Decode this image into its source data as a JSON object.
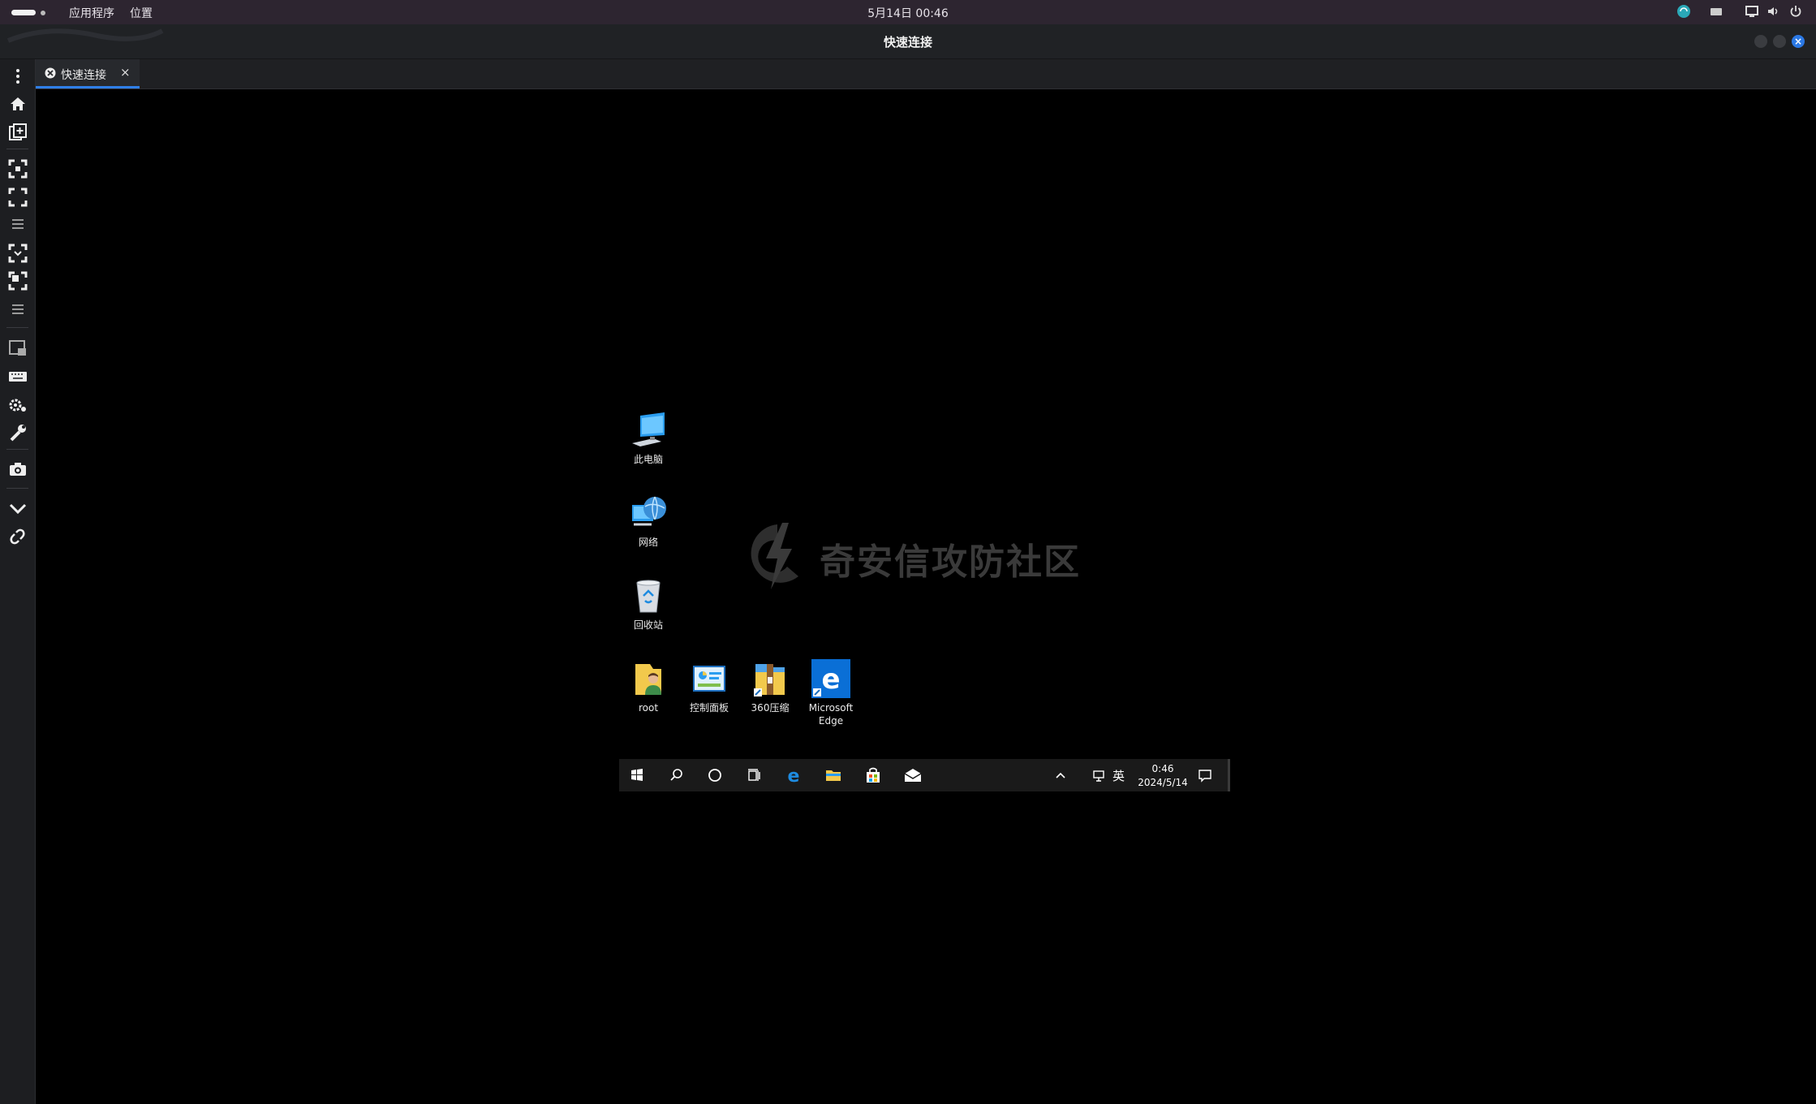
{
  "topbar": {
    "apps_menu": "应用程序",
    "places_menu": "位置",
    "clock": "5月14日 00:46",
    "tray_icons": [
      "network-icon",
      "keyboard-icon",
      "display-icon",
      "volume-icon",
      "power-icon"
    ]
  },
  "window": {
    "title": "快速连接"
  },
  "sidebar": {
    "icons": [
      "kebab-menu-icon",
      "home-icon",
      "new-tab-icon",
      "fit-window-icon",
      "fullscreen-icon",
      "menu-lines-icon",
      "zoom-fit-icon",
      "zoom-expand-icon",
      "menu-lines-icon",
      "multi-monitor-icon",
      "keyboard-icon",
      "settings-icon",
      "tools-icon",
      "screenshot-icon",
      "collapse-icon",
      "disconnect-icon"
    ]
  },
  "tab": {
    "label": "快速连接",
    "close": "×"
  },
  "desktop": {
    "icons": [
      {
        "label": "此电脑",
        "icon": "this-pc-icon"
      },
      {
        "label": "网络",
        "icon": "network-icon"
      },
      {
        "label": "回收站",
        "icon": "recycle-bin-icon"
      },
      {
        "label": "root",
        "icon": "user-folder-icon"
      },
      {
        "label": "控制面板",
        "icon": "control-panel-icon"
      },
      {
        "label": "360压缩",
        "icon": "archive-icon"
      },
      {
        "label": "Microsoft Edge",
        "icon": "edge-icon"
      }
    ],
    "watermark": "奇安信攻防社区"
  },
  "taskbar": {
    "ime": "英",
    "time": "0:46",
    "date": "2024/5/14"
  },
  "colors": {
    "accent": "#2f7fe8",
    "topbar_bg": "#2d2530",
    "titlebar_bg": "#202225"
  }
}
